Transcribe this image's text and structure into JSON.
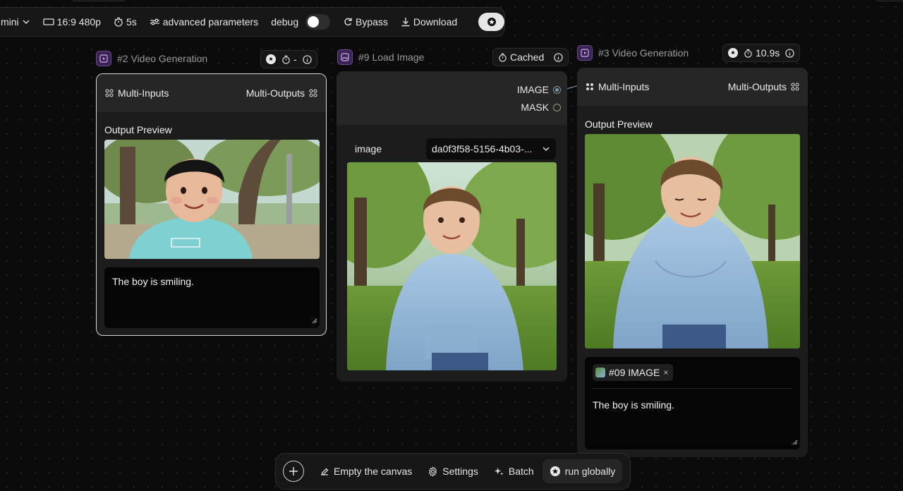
{
  "toolbar": {
    "model": "mini",
    "aspect": "16:9 480p",
    "duration": "5s",
    "advanced": "advanced parameters",
    "debug": "debug",
    "bypass": "Bypass",
    "download": "Download"
  },
  "nodes": [
    {
      "title": "#2 Video Generation",
      "timer": "-",
      "inputs": "Multi-Inputs",
      "outputs": "Multi-Outputs",
      "preview_label": "Output Preview",
      "prompt": "The boy is smiling."
    },
    {
      "title": "#9 Load Image",
      "status": "Cached",
      "ports": [
        "IMAGE",
        "MASK"
      ],
      "field_label": "image",
      "field_value": "da0f3f58-5156-4b03-..."
    },
    {
      "title": "#3 Video Generation",
      "timer": "10.9s",
      "inputs": "Multi-Inputs",
      "outputs": "Multi-Outputs",
      "preview_label": "Output Preview",
      "chip": "#09 IMAGE",
      "chip_close": "×",
      "prompt": "The boy is smiling."
    }
  ],
  "bottom": {
    "empty": "Empty the canvas",
    "settings": "Settings",
    "batch": "Batch",
    "run": "run globally"
  },
  "colors": {
    "canvas": "#0b0b0b",
    "card": "#1c1c1c",
    "card_head": "#262626",
    "node_badge": "#3a2452",
    "image_port": "#7f97ad",
    "mask_port": "#8aa37a"
  }
}
